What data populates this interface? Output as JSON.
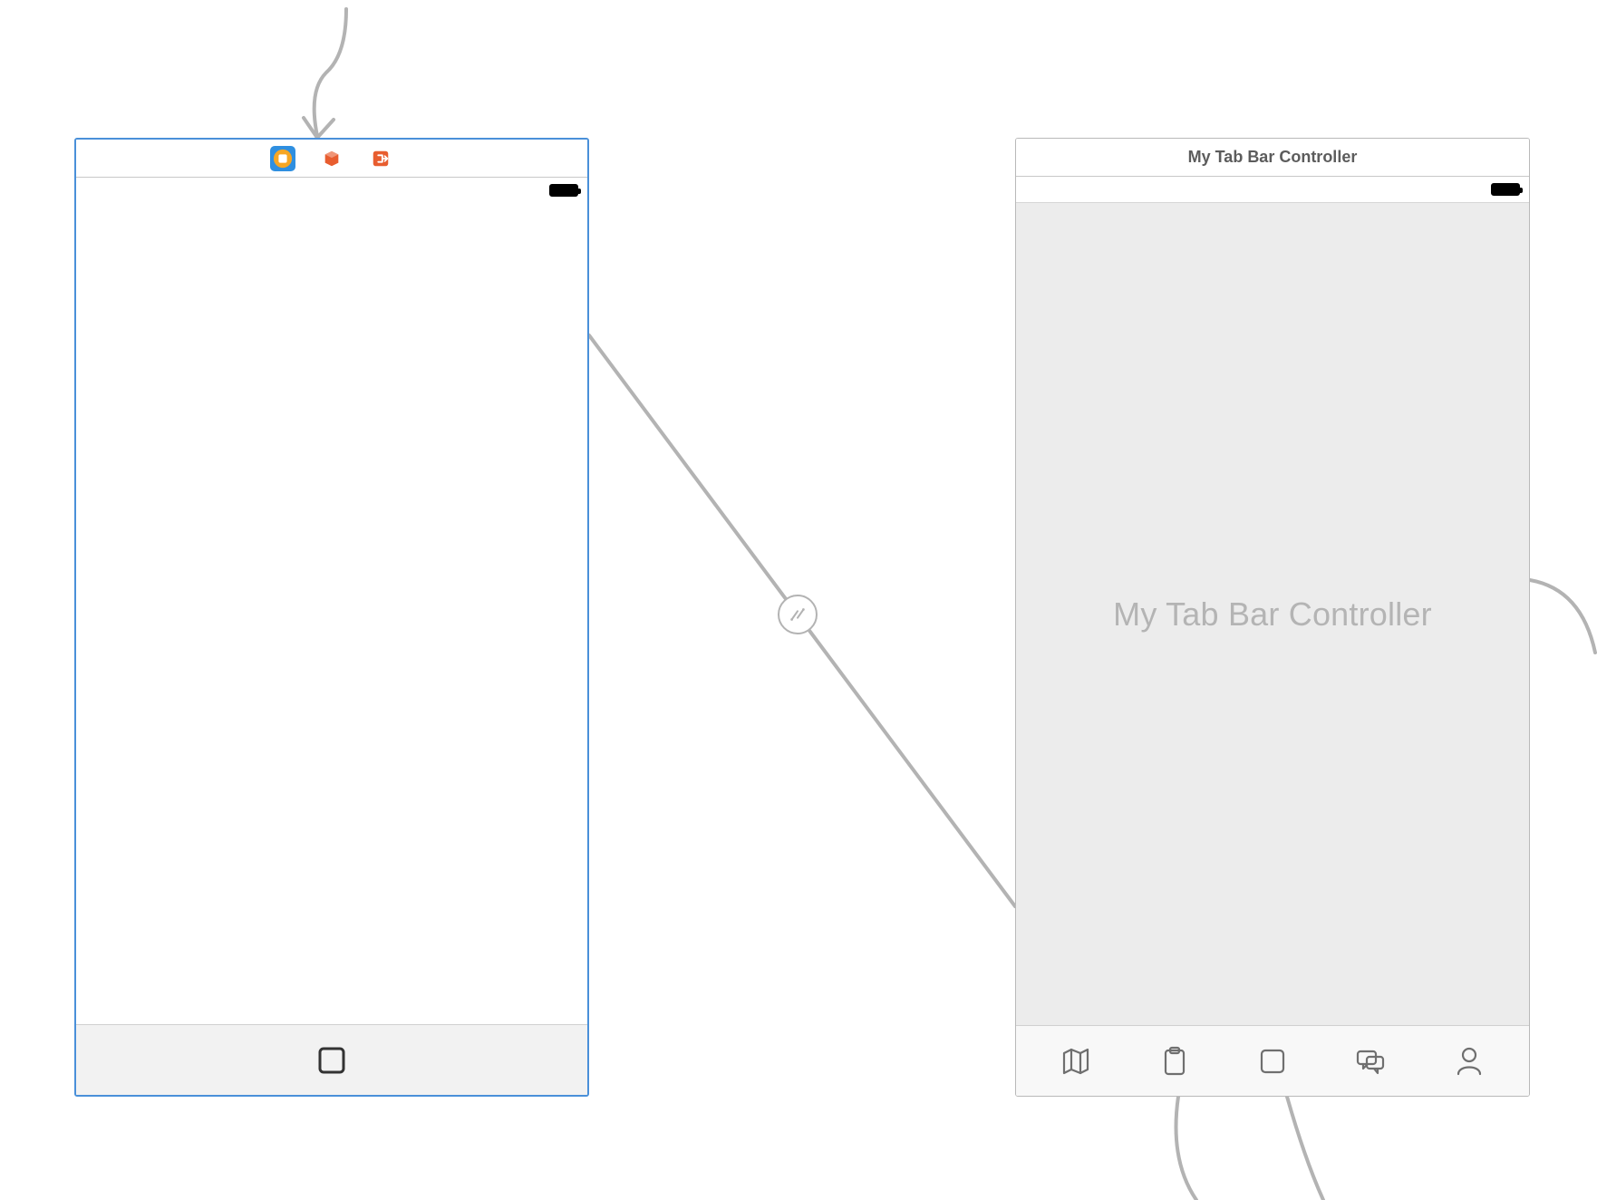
{
  "left_scene": {
    "title_icons": [
      {
        "name": "view-controller-icon",
        "selected": true
      },
      {
        "name": "first-responder-icon",
        "selected": false
      },
      {
        "name": "exit-icon",
        "selected": false
      }
    ],
    "single_tab": {
      "icon": "square-icon"
    }
  },
  "right_scene": {
    "title": "My Tab Bar Controller",
    "placeholder": "My Tab Bar Controller",
    "tabs": [
      {
        "icon": "map-icon"
      },
      {
        "icon": "clipboard-icon"
      },
      {
        "icon": "square-icon"
      },
      {
        "icon": "chat-icon"
      },
      {
        "icon": "person-icon"
      }
    ]
  }
}
